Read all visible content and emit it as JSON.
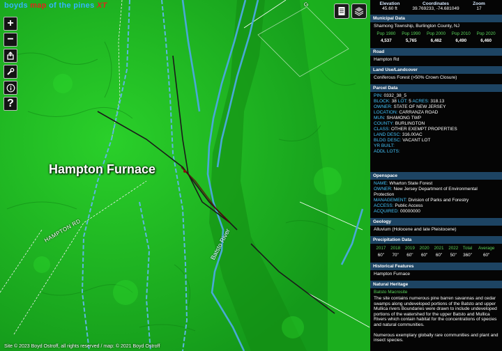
{
  "map": {
    "title_parts": [
      "boyds",
      "map",
      "of the pines",
      "XT"
    ],
    "place_label": "Hampton Furnace",
    "road_label": "HAMPTON RD",
    "river_label": "Batsto River",
    "corner_label": "G",
    "attribution": "Site © 2023 Boyd Ostroff, all rights reserved / map: © 2021 Boyd Ostroff",
    "tools": [
      {
        "name": "zoom-in-button",
        "glyph": "+"
      },
      {
        "name": "zoom-out-button",
        "glyph": "−"
      },
      {
        "name": "share-button",
        "glyph": "share"
      },
      {
        "name": "tools-button",
        "glyph": "wrench"
      },
      {
        "name": "info-button",
        "glyph": "i"
      },
      {
        "name": "help-button",
        "glyph": "?"
      }
    ],
    "colors": {
      "terrain": "#1fb51f",
      "water": "#49a9d6",
      "road": "#1a1a1a"
    }
  },
  "panel": {
    "stats": {
      "headers": [
        "Elevation",
        "Coordinates",
        "Zoom"
      ],
      "elevation": "45.60 ft",
      "coordinates": "39.769233, -74.681049",
      "zoom": "17"
    },
    "municipal": {
      "title": "Municipal Data",
      "name": "Shamong Township, Burlington County, NJ",
      "pop_headers": [
        "Pop 1980",
        "Pop 1990",
        "Pop 2000",
        "Pop 2010",
        "Pop 2020"
      ],
      "pop_values": [
        "4,537",
        "5,765",
        "6,462",
        "6,490",
        "6,460"
      ]
    },
    "road": {
      "title": "Road",
      "value": "Hampton Rd"
    },
    "landuse": {
      "title": "Land Use/Landcover",
      "value": "Coniferous Forest (>50% Crown Closure)"
    },
    "parcel": {
      "title": "Parcel Data",
      "pin_label": "PIN:",
      "pin": "0332_38_5",
      "block_label": "BLOCK:",
      "block": "38",
      "lot_label": "LOT:",
      "lot": "5",
      "acres_label": "ACRES:",
      "acres": "318.13",
      "rows": [
        {
          "label": "OWNER:",
          "value": "STATE OF NEW JERSEY"
        },
        {
          "label": "LOCATION:",
          "value": "CARRANZA ROAD"
        },
        {
          "label": "MUN:",
          "value": "SHAMONG TWP"
        },
        {
          "label": "COUNTY:",
          "value": "BURLINGTON"
        },
        {
          "label": "CLASS:",
          "value": "OTHER EXEMPT PROPERTIES"
        },
        {
          "label": "LAND DESC:",
          "value": "316.00AC"
        },
        {
          "label": "BLDG DESC:",
          "value": "VACANT LOT"
        },
        {
          "label": "YR BUILT:",
          "value": ""
        },
        {
          "label": "ADDL LOTS:",
          "value": ""
        }
      ]
    },
    "openspace": {
      "title": "Openspace",
      "rows": [
        {
          "label": "NAME:",
          "value": "Wharton State Forest"
        },
        {
          "label": "OWNER:",
          "value": "New Jersey Department of Environmental Protection"
        },
        {
          "label": "MANAGEMENT:",
          "value": "Division of Parks and Forestry"
        },
        {
          "label": "ACCESS:",
          "value": "Public Access"
        },
        {
          "label": "ACQUIRED:",
          "value": "00000000"
        }
      ]
    },
    "geology": {
      "title": "Geology",
      "value": "Alluvium (Holocene and late Pleistocene)"
    },
    "precip": {
      "title": "Precipitation Data",
      "headers": [
        "2017",
        "2018",
        "2019",
        "2020",
        "2021",
        "2022",
        "Total",
        "Average"
      ],
      "values": [
        "60\"",
        "70\"",
        "60\"",
        "60\"",
        "60\"",
        "50\"",
        "360\"",
        "60\""
      ]
    },
    "historical": {
      "title": "Historical Features",
      "value": "Hampton Furnace"
    },
    "heritage": {
      "title": "Natural Heritage",
      "name": "Batsto Macrosite",
      "p1": "The site contains numerous pine barren savannas and cedar swamps along undeveloped portions of the Batsto and upper Mullica rivers Boundaries were drawn to include undeveloped portions of the watershed for the upper Batsto and Mullica Rivers which contain habitat for the concentrations of species and natural communities.",
      "p2": "Numerous exemplary globally rare communities and plant and insect species."
    }
  }
}
